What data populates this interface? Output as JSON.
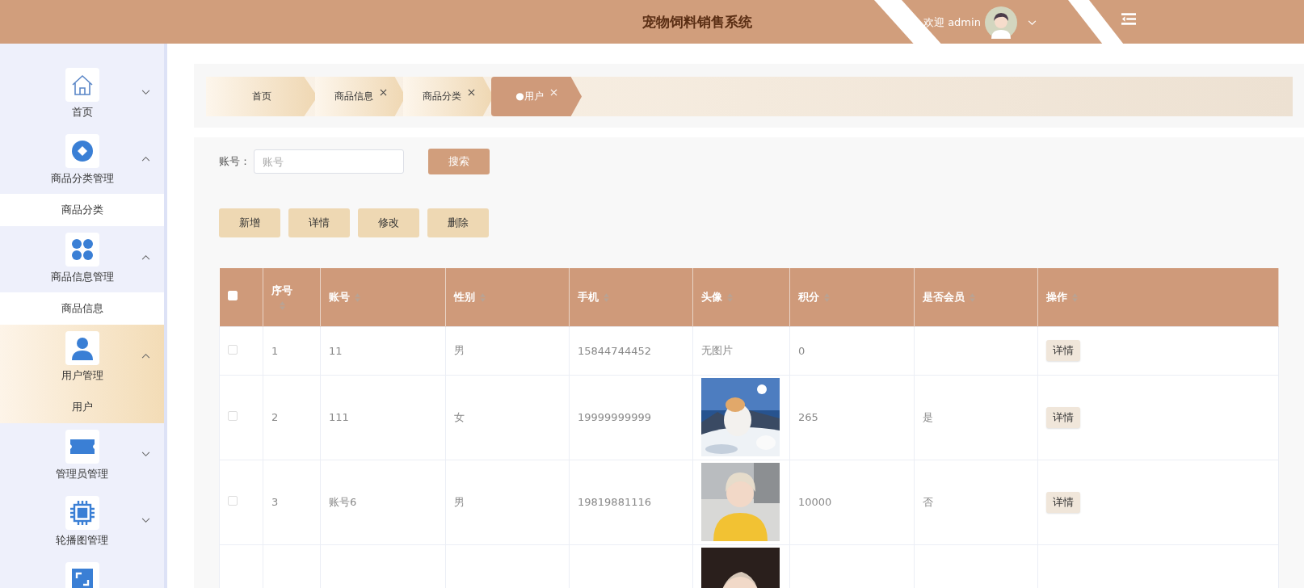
{
  "header": {
    "title": "宠物饲料销售系统",
    "welcome": "欢迎 admin"
  },
  "sidebar": {
    "items": [
      {
        "label": "首页",
        "expanded": false,
        "selected": false
      },
      {
        "label": "商品分类管理",
        "expanded": true,
        "selected": false,
        "children": [
          {
            "label": "商品分类",
            "selected": false
          }
        ]
      },
      {
        "label": "商品信息管理",
        "expanded": true,
        "selected": false,
        "children": [
          {
            "label": "商品信息",
            "selected": false
          }
        ]
      },
      {
        "label": "用户管理",
        "expanded": true,
        "selected": true,
        "children": [
          {
            "label": "用户",
            "selected": true
          }
        ]
      },
      {
        "label": "管理员管理",
        "expanded": false,
        "selected": false
      },
      {
        "label": "轮播图管理",
        "expanded": false,
        "selected": false
      },
      {
        "selected": false
      }
    ]
  },
  "breadcrumb": [
    {
      "label": "首页",
      "closable": false,
      "selected": false
    },
    {
      "label": "商品信息",
      "closable": true,
      "selected": false
    },
    {
      "label": "商品分类",
      "closable": true,
      "selected": false
    },
    {
      "label": "●用户",
      "closable": true,
      "selected": true
    }
  ],
  "search": {
    "label": "账号：",
    "placeholder": "账号",
    "button": "搜索"
  },
  "actions": [
    "新增",
    "详情",
    "修改",
    "删除"
  ],
  "table": {
    "select_all": {
      "checked": false
    },
    "columns": [
      {
        "label": "序号",
        "sortable": true
      },
      {
        "label": "账号",
        "sortable": true
      },
      {
        "label": "性别",
        "sortable": true
      },
      {
        "label": "手机",
        "sortable": true
      },
      {
        "label": "头像",
        "sortable": true
      },
      {
        "label": "积分",
        "sortable": true
      },
      {
        "label": "是否会员",
        "sortable": true
      },
      {
        "label": "操作",
        "sortable": true
      }
    ],
    "rows": [
      {
        "checked": false,
        "cells": [
          "1",
          "11",
          "男",
          "15844744452"
        ],
        "avatar": {
          "kind": "text",
          "text": "无图片"
        },
        "points": "0",
        "member": "",
        "action": "详情"
      },
      {
        "checked": false,
        "cells": [
          "2",
          "111",
          "女",
          "19999999999"
        ],
        "points": "265",
        "member": "是",
        "action": "详情"
      },
      {
        "checked": false,
        "cells": [
          "3",
          "账号6",
          "男",
          "19819881116"
        ],
        "points": "10000",
        "member": "否",
        "action": "详情"
      },
      {
        "cells": [
          "",
          "",
          "",
          ""
        ],
        "points": "",
        "member": ""
      }
    ]
  }
}
